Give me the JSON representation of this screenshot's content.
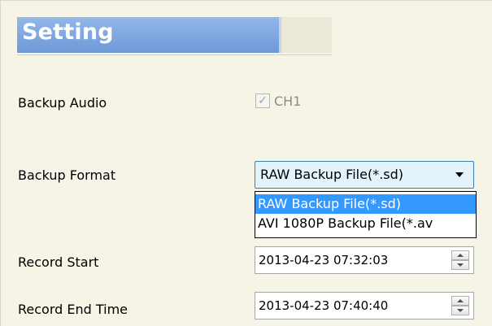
{
  "header": {
    "title": "Setting"
  },
  "backup_audio": {
    "label": "Backup Audio",
    "checkbox_label": "CH1",
    "checked": true
  },
  "backup_format": {
    "label": "Backup Format",
    "selected": "RAW Backup File(*.sd)",
    "options": [
      "RAW Backup File(*.sd)",
      "AVI 1080P Backup File(*.av"
    ]
  },
  "record_start": {
    "label": "Record Start",
    "value": "2013-04-23 07:32:03"
  },
  "record_end": {
    "label": "Record End Time",
    "value": "2013-04-23 07:40:40"
  },
  "colors": {
    "header_accent": "#6e98d8",
    "selection": "#3399ff"
  }
}
